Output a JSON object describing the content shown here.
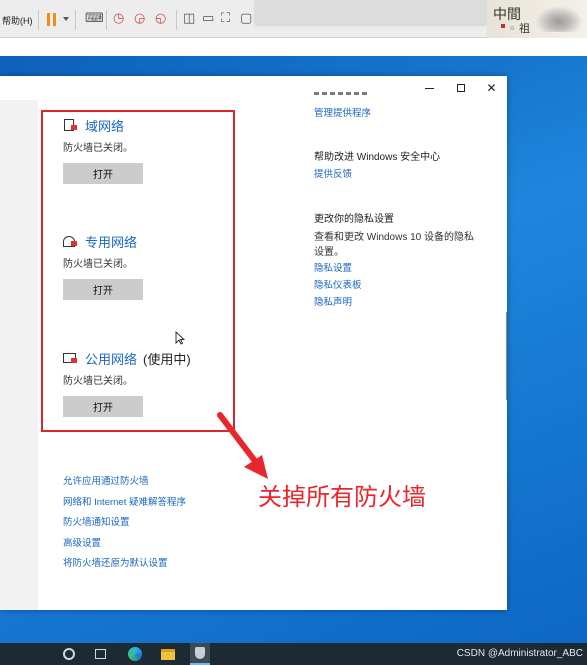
{
  "vm_toolbar": {
    "help_label": "帮助(H)",
    "stamp_glyph_a": "中間",
    "stamp_glyph_b": "◦ 祖"
  },
  "window": {
    "controls": [
      "minimize",
      "maximize",
      "close"
    ],
    "networks": [
      {
        "icon": "domain-network-icon",
        "title": "域网络",
        "in_use": "",
        "status": "防火墙已关闭。",
        "button": "打开"
      },
      {
        "icon": "private-network-icon",
        "title": "专用网络",
        "in_use": "",
        "status": "防火墙已关闭。",
        "button": "打开"
      },
      {
        "icon": "public-network-icon",
        "title": "公用网络",
        "in_use": "(使用中)",
        "status": "防火墙已关闭。",
        "button": "打开"
      }
    ],
    "right_panel": {
      "link_manage_providers": "管理提供程序",
      "help_improve_heading": "帮助改进 Windows 安全中心",
      "link_feedback": "提供反馈",
      "privacy_heading": "更改你的隐私设置",
      "privacy_text_line1": "查看和更改 Windows 10 设备的隐私",
      "privacy_text_line2": "设置。",
      "privacy_links": [
        "隐私设置",
        "隐私仪表板",
        "隐私声明"
      ]
    },
    "bottom_links": [
      "允许应用通过防火墙",
      "网络和 Internet 疑难解答程序",
      "防火墙通知设置",
      "高级设置",
      "将防火墙还原为默认设置"
    ]
  },
  "annotation": {
    "text": "关掉所有防火墙",
    "color": "#e8262c"
  },
  "taskbar": {
    "watermark": "CSDN @Administrator_ABC",
    "items": [
      "search-icon",
      "task-view-icon",
      "edge-icon",
      "file-explorer-icon",
      "windows-security-icon"
    ]
  },
  "colors": {
    "link": "#1a66c2",
    "highlight_box": "#d9262c",
    "desktop": "#1572c9"
  }
}
